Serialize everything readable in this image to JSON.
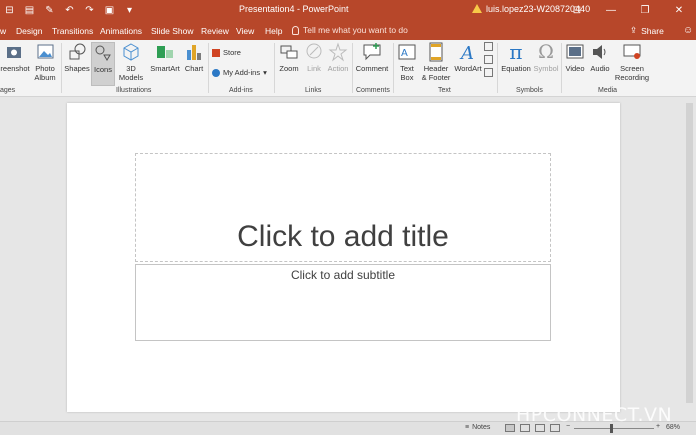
{
  "titlebar": {
    "title": "Presentation4  -  PowerPoint",
    "user": "luis.lopez23-W208720440",
    "qat_icons": [
      "slideshow-icon",
      "save-icon",
      "pen-icon",
      "undo-icon",
      "redo-icon",
      "present-icon",
      "customize-icon"
    ],
    "qat_glyphs": [
      "⊟",
      "▤",
      "✎",
      "↶",
      "↷",
      "▣",
      "▾"
    ],
    "controls": [
      "⊡",
      "—",
      "❐",
      "✕"
    ]
  },
  "tabs": [
    "w",
    "Design",
    "Transitions",
    "Animations",
    "Slide Show",
    "Review",
    "View",
    "Help"
  ],
  "tell_me": "Tell me what you want to do",
  "share": "Share",
  "ribbon": {
    "screenshot": "reenshot",
    "photo_album_1": "Photo",
    "photo_album_2": "Album",
    "shapes": "Shapes",
    "icons": "Icons",
    "models_1": "3D",
    "models_2": "Models",
    "smartart": "SmartArt",
    "chart": "Chart",
    "store": "Store",
    "my_addins": "My Add-ins",
    "zoom": "Zoom",
    "link": "Link",
    "action": "Action",
    "comment": "Comment",
    "textbox_1": "Text",
    "textbox_2": "Box",
    "header_1": "Header",
    "header_2": "& Footer",
    "wordart": "WordArt",
    "equation": "Equation",
    "symbol": "Symbol",
    "video": "Video",
    "audio": "Audio",
    "screenrec_1": "Screen",
    "screenrec_2": "Recording",
    "groups": {
      "images": "ages",
      "illustrations": "Illustrations",
      "addins": "Add-ins",
      "links": "Links",
      "comments": "Comments",
      "text": "Text",
      "symbols": "Symbols",
      "media": "Media"
    }
  },
  "slide": {
    "title_placeholder": "Click to add title",
    "subtitle_placeholder": "Click to add subtitle"
  },
  "status": {
    "notes": "Notes",
    "zoom": "68%",
    "zoom_minus": "−",
    "zoom_plus": "+"
  },
  "watermark": "HPCONNECT.VN",
  "colors": {
    "accent": "#b7472a",
    "ribbon_bg": "#f3f3f3",
    "canvas": "#e6e6e6"
  }
}
